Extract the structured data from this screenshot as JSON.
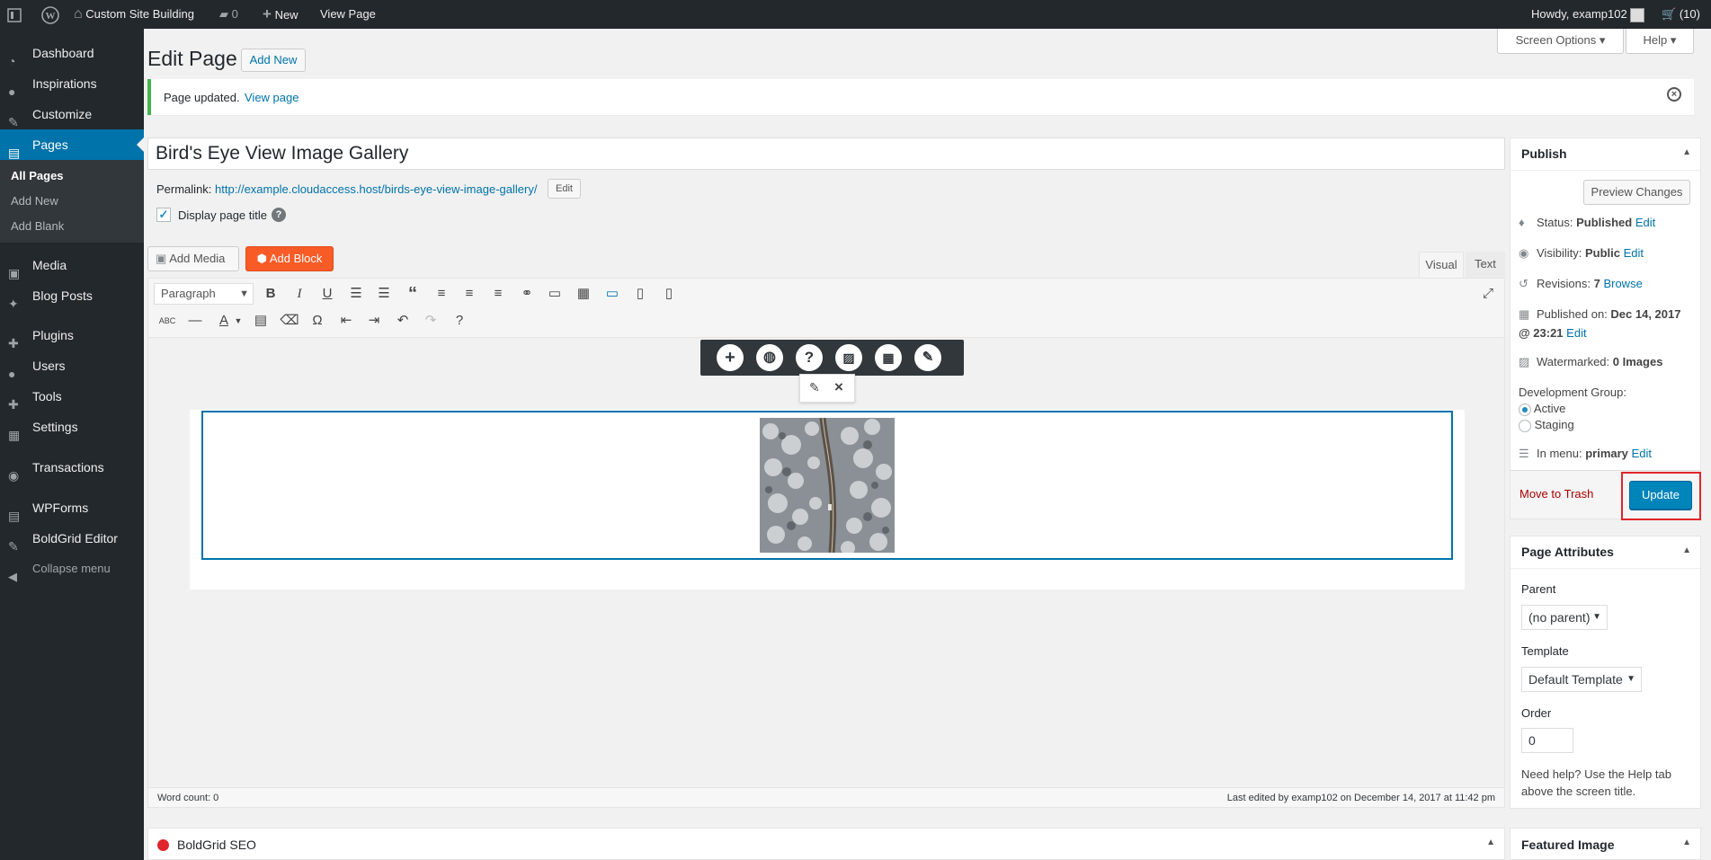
{
  "adminbar": {
    "site_name": "Custom Site Building",
    "comments": "0",
    "new": "New",
    "view_page": "View Page",
    "howdy": "Howdy, examp102",
    "cart": "(10)"
  },
  "sidebar": {
    "items": [
      "Dashboard",
      "Inspirations",
      "Customize",
      "Pages",
      "Media",
      "Blog Posts",
      "Plugins",
      "Users",
      "Tools",
      "Settings",
      "Transactions",
      "WPForms",
      "BoldGrid Editor",
      "Collapse menu"
    ],
    "subitems": [
      "All Pages",
      "Add New",
      "Add Blank"
    ]
  },
  "screen_options": "Screen Options",
  "help": "Help",
  "page_heading": "Edit Page",
  "add_new": "Add New",
  "notice": {
    "text": "Page updated.",
    "link": "View page"
  },
  "title_value": "Bird's Eye View Image Gallery",
  "permalink": {
    "label": "Permalink:",
    "base": "http://example.cloudaccess.host/",
    "slug": "birds-eye-view-image-gallery",
    "slash": "/",
    "edit": "Edit"
  },
  "display_title": "Display page title",
  "add_media": "Add Media",
  "add_block": "Add Block",
  "tab_visual": "Visual",
  "tab_text": "Text",
  "paragraph": "Paragraph",
  "word_count": "Word count: 0",
  "last_edited": "Last edited by examp102 on December 14, 2017 at 11:42 pm",
  "seo_title": "BoldGrid SEO",
  "publish": {
    "title": "Publish",
    "preview": "Preview Changes",
    "status_label": "Status:",
    "status_value": "Published",
    "visibility_label": "Visibility:",
    "visibility_value": "Public",
    "revisions_label": "Revisions:",
    "revisions_value": "7",
    "browse": "Browse",
    "published_on_label": "Published on:",
    "published_on_value": "Dec 14, 2017",
    "published_time": "@ 23:21",
    "watermarked_label": "Watermarked:",
    "watermarked_value": "0 Images",
    "dev_group": "Development Group:",
    "active": "Active",
    "staging": "Staging",
    "in_menu_label": "In menu:",
    "in_menu_value": "primary",
    "edit": "Edit",
    "trash": "Move to Trash",
    "update": "Update"
  },
  "attributes": {
    "title": "Page Attributes",
    "parent_label": "Parent",
    "parent_value": "(no parent)",
    "template_label": "Template",
    "template_value": "Default Template",
    "order_label": "Order",
    "order_value": "0",
    "help_text_1": "Need help? Use the Help tab",
    "help_text_2": "above the screen title."
  },
  "featured_image": "Featured Image",
  "colors": {
    "accent": "#0073aa",
    "admin_bar": "#23282d",
    "add_block": "#f95b26",
    "highlight": "#e0262a"
  }
}
